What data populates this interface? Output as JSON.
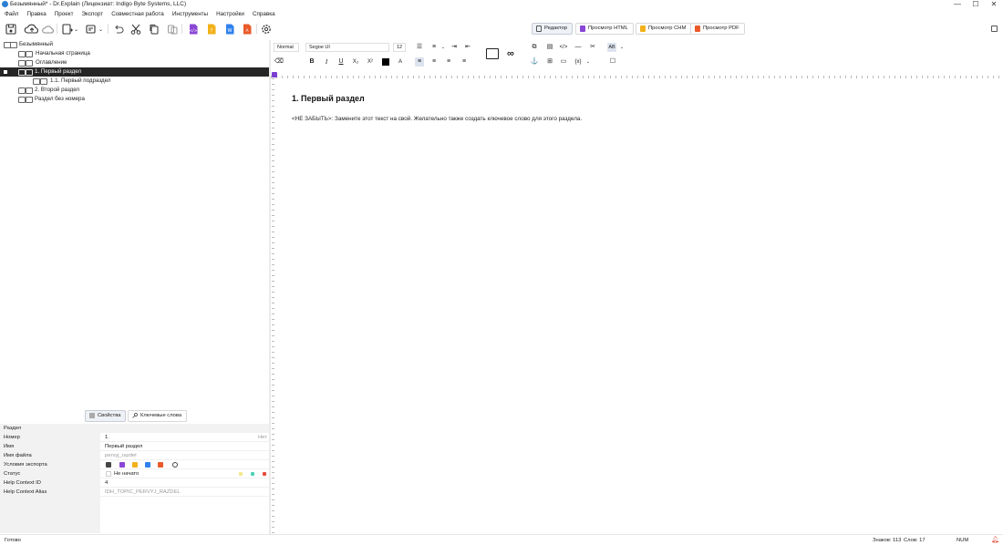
{
  "window": {
    "title": "Безымянный* - Dr.Explain (Лицензиат: Indigo Byte Systems, LLC)",
    "minimize": "—",
    "maximize": "☐",
    "close": "✕"
  },
  "menu": [
    "Файл",
    "Правка",
    "Проект",
    "Экспорт",
    "Совместная работа",
    "Инструменты",
    "Настройки",
    "Справка"
  ],
  "view_buttons": {
    "editor": "Редактор",
    "html": "Просмотр HTML",
    "chm": "Просмотр CHM",
    "pdf": "Просмотр PDF"
  },
  "tree": {
    "root": "Безымянный",
    "items": [
      {
        "label": "Начальная страница"
      },
      {
        "label": "Оглавление"
      },
      {
        "label": "1. Первый раздел"
      },
      {
        "label": "1.1. Первый подраздел"
      },
      {
        "label": "2. Второй раздел"
      },
      {
        "label": "Раздел без номера"
      }
    ]
  },
  "props_tabs": {
    "properties": "Свойства",
    "keywords": "Ключевые слова"
  },
  "props": {
    "section": "Раздел",
    "number_label": "Номер",
    "number_value": "1.",
    "number_hint": "Нет",
    "name_label": "Имя",
    "name_value": "Первый раздел",
    "filename_label": "Имя файла",
    "filename_value": "pervyj_razdel",
    "export_label": "Условия экспорта",
    "status_label": "Статус",
    "status_value": "Не начато",
    "help_id_label": "Help Context ID",
    "help_id_value": "4",
    "help_alias_label": "Help Context Alias",
    "help_alias_value": "IDH_TOPIC_PERVYJ_RAZDEL"
  },
  "format": {
    "style": "Normal",
    "font": "Segoe UI",
    "size": "12"
  },
  "document": {
    "heading": "1. Первый раздел",
    "body": "<НЕ ЗАБЫТЬ>: Замените этот текст на свой. Желательно также создать ключевое слово для этого раздела."
  },
  "status": {
    "ready": "Готово",
    "chars": "Знаков: 113",
    "words": "Слов: 17",
    "num": "NUM"
  },
  "colors": {
    "accent": "#7a3fd1",
    "selection": "#262626",
    "html_icon": "#8a46d6",
    "chm_icon": "#f2b21b",
    "pdf_icon": "#ea5a2a",
    "word_icon": "#2f80ed"
  }
}
